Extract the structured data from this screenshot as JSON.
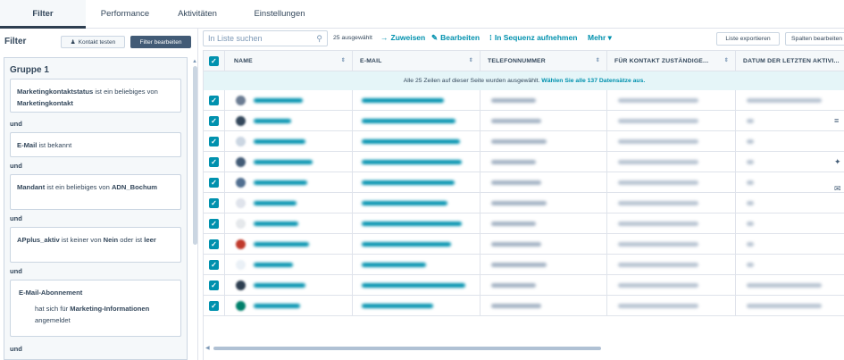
{
  "tabs": [
    {
      "label": "Filter",
      "active": true
    },
    {
      "label": "Performance",
      "active": false
    },
    {
      "label": "Aktivitäten",
      "active": false
    },
    {
      "label": "Einstellungen",
      "active": false
    }
  ],
  "filter_panel": {
    "title": "Filter",
    "test_button": "Kontakt testen",
    "edit_button": "Filter bearbeiten",
    "group_title": "Gruppe 1",
    "and_label": "und",
    "conditions": [
      {
        "parts": [
          {
            "t": "Marketingkontaktstatus",
            "b": true
          },
          {
            "t": " ist ein beliebiges von ",
            "b": false
          },
          {
            "t": "Marketingkontakt",
            "b": true
          }
        ]
      },
      {
        "parts": [
          {
            "t": "E-Mail",
            "b": true
          },
          {
            "t": " ist bekannt",
            "b": false
          }
        ]
      },
      {
        "parts": [
          {
            "t": "Mandant",
            "b": true
          },
          {
            "t": " ist ein beliebiges von ",
            "b": false
          },
          {
            "t": "ADN_Bochum",
            "b": true
          }
        ]
      },
      {
        "parts": [
          {
            "t": "APplus_aktiv",
            "b": true
          },
          {
            "t": " ist keiner von ",
            "b": false
          },
          {
            "t": "Nein",
            "b": true
          },
          {
            "t": " oder ist ",
            "b": false
          },
          {
            "t": "leer",
            "b": true
          }
        ]
      },
      {
        "heading": "E-Mail-Abonnement",
        "parts": [
          {
            "t": "hat sich für ",
            "b": false
          },
          {
            "t": "Marketing-Informationen",
            "b": true
          },
          {
            "t": " angemeldet",
            "b": false
          }
        ]
      }
    ]
  },
  "toolbar": {
    "search_placeholder": "In Liste suchen",
    "selected_count": "25 ausgewählt",
    "actions": [
      {
        "icon": "arrow-right-icon",
        "glyph": "→",
        "label": "Zuweisen"
      },
      {
        "icon": "pencil-icon",
        "glyph": "✎",
        "label": "Bearbeiten"
      },
      {
        "icon": "sequence-icon",
        "glyph": "⁞",
        "label": "In Sequenz aufnehmen"
      },
      {
        "icon": "chevron-down-icon",
        "glyph": "",
        "label": "Mehr ▾"
      }
    ],
    "export_button": "Liste exportieren",
    "columns_button": "Spalten bearbeiten"
  },
  "table": {
    "columns": [
      "NAME",
      "E-MAIL",
      "TELEFONNUMMER",
      "FÜR KONTAKT ZUSTÄNDIGE...",
      "DATUM DER LETZTEN AKTIVI..."
    ],
    "banner_text": "Alle 25 Zeilen auf dieser Seite wurden ausgewählt.",
    "banner_link": "Wählen Sie alle 137 Datensätze aus.",
    "row_count_visible": 11,
    "rows_note": "blurred"
  },
  "colors": {
    "accent": "#0091ae",
    "dark_button": "#425b76",
    "text": "#33475b",
    "border": "#dfe3eb",
    "header_bg": "#f5f8fa",
    "banner_bg": "#e5f5f8"
  }
}
